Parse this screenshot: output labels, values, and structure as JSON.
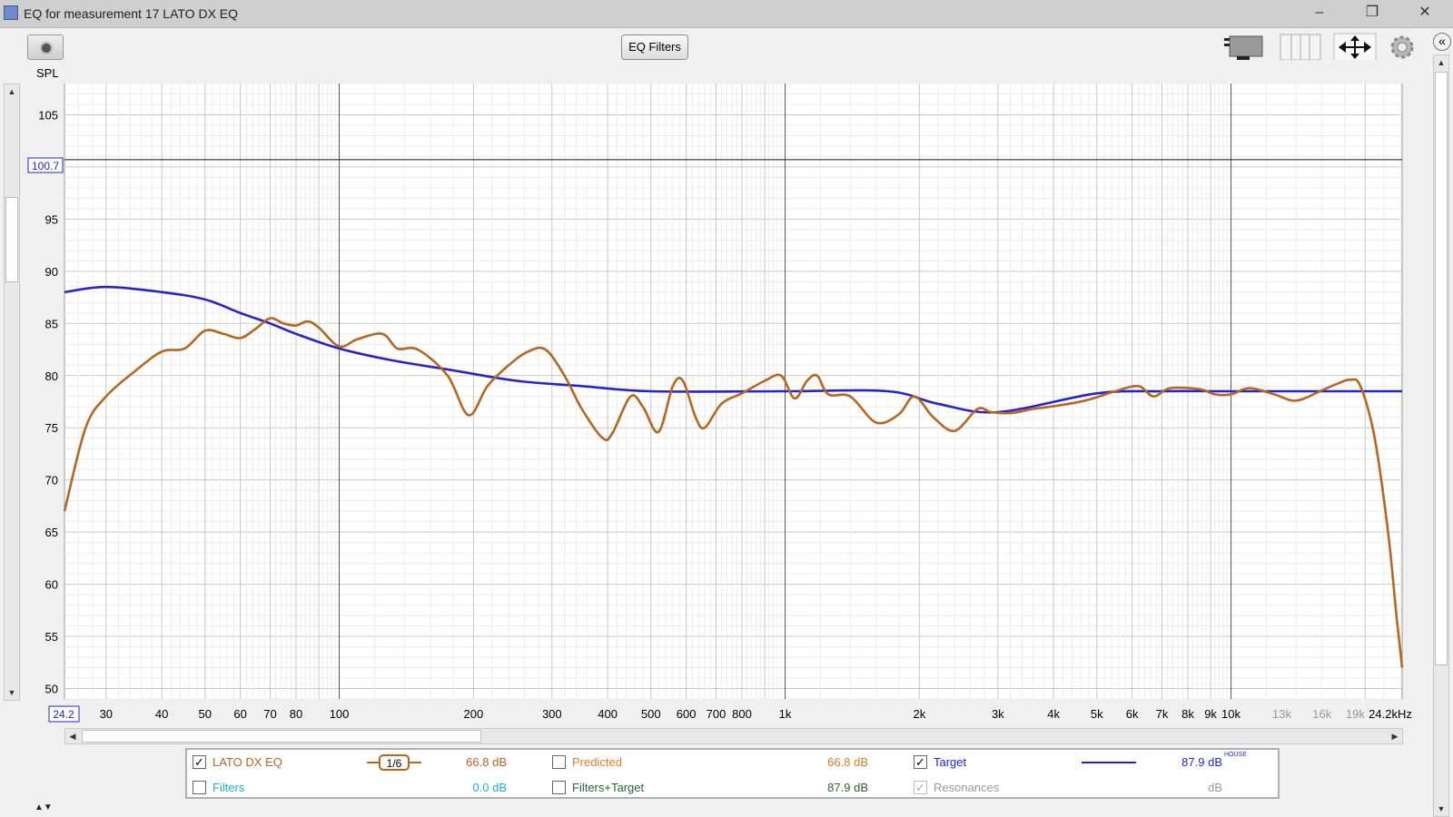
{
  "window": {
    "title": "EQ for measurement 17 LATO DX EQ",
    "minimize": "–",
    "restore": "❐",
    "close": "✕"
  },
  "toolbar": {
    "eq_filters_label": "EQ Filters",
    "spl_label": "SPL",
    "collapse_label": "«"
  },
  "graph": {
    "cursor_value": "100.7",
    "freq_start_label": "24.2",
    "freq_end_label": "24.2kHz"
  },
  "chart_data": {
    "type": "line",
    "xlabel": "",
    "ylabel": "SPL",
    "x_scale": "log",
    "xlim": [
      24.2,
      24200
    ],
    "ylim": [
      49,
      108
    ],
    "grid": true,
    "y_ticks": [
      50,
      55,
      60,
      65,
      70,
      75,
      80,
      85,
      90,
      95,
      105
    ],
    "x_ticks": [
      {
        "v": 30,
        "l": "30"
      },
      {
        "v": 40,
        "l": "40"
      },
      {
        "v": 50,
        "l": "50"
      },
      {
        "v": 60,
        "l": "60"
      },
      {
        "v": 70,
        "l": "70"
      },
      {
        "v": 80,
        "l": "80"
      },
      {
        "v": 100,
        "l": "100"
      },
      {
        "v": 200,
        "l": "200"
      },
      {
        "v": 300,
        "l": "300"
      },
      {
        "v": 400,
        "l": "400"
      },
      {
        "v": 500,
        "l": "500"
      },
      {
        "v": 600,
        "l": "600"
      },
      {
        "v": 700,
        "l": "700"
      },
      {
        "v": 800,
        "l": "800"
      },
      {
        "v": 1000,
        "l": "1k"
      },
      {
        "v": 2000,
        "l": "2k"
      },
      {
        "v": 3000,
        "l": "3k"
      },
      {
        "v": 4000,
        "l": "4k"
      },
      {
        "v": 5000,
        "l": "5k"
      },
      {
        "v": 6000,
        "l": "6k"
      },
      {
        "v": 7000,
        "l": "7k"
      },
      {
        "v": 8000,
        "l": "8k"
      },
      {
        "v": 9000,
        "l": "9k"
      },
      {
        "v": 10000,
        "l": "10k"
      },
      {
        "v": 13000,
        "l": "13k"
      },
      {
        "v": 16000,
        "l": "16k"
      },
      {
        "v": 19000,
        "l": "19k"
      }
    ],
    "cursor_y": 100.7,
    "series": [
      {
        "name": "Target",
        "color": "#2323d6",
        "points": [
          [
            24.2,
            88
          ],
          [
            30,
            88.5
          ],
          [
            40,
            88
          ],
          [
            50,
            87.3
          ],
          [
            60,
            86
          ],
          [
            70,
            85
          ],
          [
            80,
            84
          ],
          [
            100,
            82.6
          ],
          [
            130,
            81.5
          ],
          [
            180,
            80.5
          ],
          [
            250,
            79.5
          ],
          [
            350,
            79
          ],
          [
            500,
            78.5
          ],
          [
            1000,
            78.5
          ],
          [
            1700,
            78.5
          ],
          [
            2200,
            77.3
          ],
          [
            3000,
            76.5
          ],
          [
            5000,
            78.3
          ],
          [
            7000,
            78.5
          ],
          [
            10000,
            78.5
          ],
          [
            24200,
            78.5
          ]
        ]
      },
      {
        "name": "LATO DX EQ",
        "color": "#b8651e",
        "points": [
          [
            24.2,
            67
          ],
          [
            27,
            75
          ],
          [
            30,
            78
          ],
          [
            35,
            80.5
          ],
          [
            40,
            82.3
          ],
          [
            45,
            82.6
          ],
          [
            50,
            84.3
          ],
          [
            55,
            84
          ],
          [
            60,
            83.6
          ],
          [
            65,
            84.5
          ],
          [
            70,
            85.5
          ],
          [
            75,
            85
          ],
          [
            80,
            84.8
          ],
          [
            85,
            85.2
          ],
          [
            90,
            84.6
          ],
          [
            100,
            82.8
          ],
          [
            110,
            83.5
          ],
          [
            125,
            84
          ],
          [
            135,
            82.6
          ],
          [
            150,
            82.5
          ],
          [
            175,
            80
          ],
          [
            195,
            76.2
          ],
          [
            215,
            79
          ],
          [
            240,
            81
          ],
          [
            265,
            82.3
          ],
          [
            290,
            82.5
          ],
          [
            320,
            80
          ],
          [
            350,
            76.8
          ],
          [
            390,
            74
          ],
          [
            410,
            74.5
          ],
          [
            450,
            78
          ],
          [
            480,
            77
          ],
          [
            520,
            74.6
          ],
          [
            560,
            79
          ],
          [
            590,
            79.5
          ],
          [
            630,
            76
          ],
          [
            660,
            75
          ],
          [
            720,
            77.3
          ],
          [
            800,
            78.3
          ],
          [
            900,
            79.5
          ],
          [
            980,
            80
          ],
          [
            1050,
            77.8
          ],
          [
            1120,
            79.5
          ],
          [
            1180,
            80
          ],
          [
            1250,
            78.2
          ],
          [
            1400,
            78
          ],
          [
            1600,
            75.5
          ],
          [
            1800,
            76.3
          ],
          [
            1950,
            78
          ],
          [
            2150,
            76
          ],
          [
            2400,
            74.7
          ],
          [
            2700,
            76.8
          ],
          [
            2900,
            76.5
          ],
          [
            3200,
            76.4
          ],
          [
            3600,
            76.8
          ],
          [
            4200,
            77.2
          ],
          [
            4800,
            77.7
          ],
          [
            5500,
            78.5
          ],
          [
            6200,
            79
          ],
          [
            6700,
            78
          ],
          [
            7300,
            78.8
          ],
          [
            8500,
            78.7
          ],
          [
            9200,
            78.2
          ],
          [
            10000,
            78.2
          ],
          [
            11000,
            78.8
          ],
          [
            12500,
            78.2
          ],
          [
            14000,
            77.6
          ],
          [
            16000,
            78.6
          ],
          [
            17500,
            79.3
          ],
          [
            18500,
            79.6
          ],
          [
            19500,
            79
          ],
          [
            21000,
            74
          ],
          [
            22500,
            65
          ],
          [
            23500,
            57
          ],
          [
            24200,
            52
          ]
        ]
      }
    ]
  },
  "legend": {
    "row1": {
      "measurement_name": "LATO DX EQ",
      "smoothing": "1/6",
      "measurement_value": "66.8 dB",
      "predicted_label": "Predicted",
      "predicted_value": "66.8 dB",
      "target_label": "Target",
      "target_value": "87.9 dB",
      "target_curve": "HOUSE"
    },
    "row2": {
      "filters_label": "Filters",
      "filters_value": "0.0 dB",
      "filters_target_label": "Filters+Target",
      "filters_target_value": "87.9 dB",
      "resonances_label": "Resonances",
      "resonances_value": "dB"
    },
    "colors": {
      "measurement": "#b8651e",
      "predicted": "#e07a2a",
      "target": "#2323d6",
      "filters": "#18b0c8",
      "filters_target": "#2a5f3a",
      "resonances": "#9a9a9a"
    }
  }
}
